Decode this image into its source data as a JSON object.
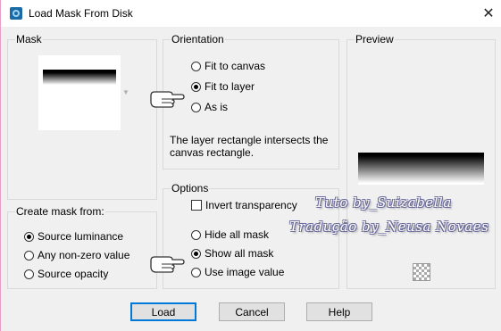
{
  "window": {
    "title": "Load Mask From Disk"
  },
  "mask": {
    "group_label": "Mask"
  },
  "orientation": {
    "group_label": "Orientation",
    "options": [
      {
        "label": "Fit to canvas",
        "selected": false
      },
      {
        "label": "Fit to layer",
        "selected": true
      },
      {
        "label": "As is",
        "selected": false
      }
    ],
    "description": "The layer rectangle intersects the canvas rectangle."
  },
  "preview": {
    "group_label": "Preview"
  },
  "create_mask_from": {
    "group_label": "Create mask from:",
    "options": [
      {
        "label": "Source luminance",
        "selected": true
      },
      {
        "label": "Any non-zero value",
        "selected": false
      },
      {
        "label": "Source opacity",
        "selected": false
      }
    ]
  },
  "options": {
    "group_label": "Options",
    "invert_label": "Invert transparency",
    "invert_checked": false,
    "choices": [
      {
        "label": "Hide all mask",
        "selected": false
      },
      {
        "label": "Show all mask",
        "selected": true
      },
      {
        "label": "Use image value",
        "selected": false
      }
    ]
  },
  "buttons": {
    "load": "Load",
    "cancel": "Cancel",
    "help": "Help"
  },
  "watermark": {
    "line1": "Tuto by_Suizabella",
    "line2": "Tradução by_Neusa Novaes"
  },
  "colors": {
    "accent": "#0078d7",
    "window_bg": "#f0f0f0",
    "group_border": "#d9d9d9"
  }
}
